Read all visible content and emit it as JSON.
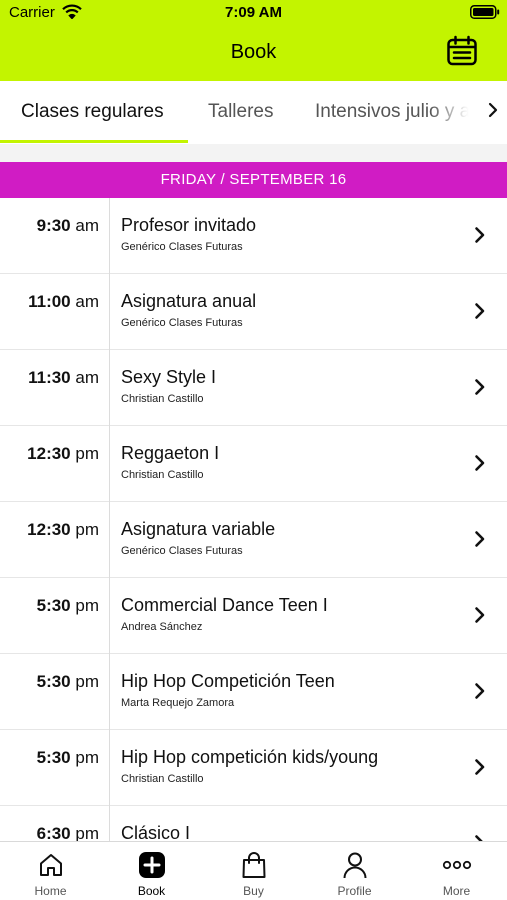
{
  "status_bar": {
    "carrier": "Carrier",
    "time": "7:09 AM"
  },
  "nav": {
    "title": "Book",
    "accent_color": "#c3f400",
    "calendar_icon": "calendar-icon"
  },
  "tabs": [
    {
      "label": "Clases regulares",
      "active": true
    },
    {
      "label": "Talleres",
      "active": false
    },
    {
      "label": "Intensivos julio y a",
      "active": false
    }
  ],
  "date_header": {
    "label": "FRIDAY / SEPTEMBER 16",
    "color": "#d01cc4"
  },
  "classes": [
    {
      "time": "9:30",
      "ampm": "am",
      "title": "Profesor invitado",
      "instructor": "Genérico Clases Futuras"
    },
    {
      "time": "11:00",
      "ampm": "am",
      "title": "Asignatura anual",
      "instructor": "Genérico Clases Futuras"
    },
    {
      "time": "11:30",
      "ampm": "am",
      "title": "Sexy Style I",
      "instructor": "Christian Castillo"
    },
    {
      "time": "12:30",
      "ampm": "pm",
      "title": "Reggaeton I",
      "instructor": "Christian Castillo"
    },
    {
      "time": "12:30",
      "ampm": "pm",
      "title": "Asignatura variable",
      "instructor": "Genérico Clases Futuras"
    },
    {
      "time": "5:30",
      "ampm": "pm",
      "title": "Commercial Dance Teen I",
      "instructor": "Andrea Sánchez"
    },
    {
      "time": "5:30",
      "ampm": "pm",
      "title": "Hip Hop Competición Teen",
      "instructor": "Marta Requejo Zamora"
    },
    {
      "time": "5:30",
      "ampm": "pm",
      "title": "Hip Hop competición kids/young",
      "instructor": "Christian Castillo"
    },
    {
      "time": "6:30",
      "ampm": "pm",
      "title": "Clásico I",
      "instructor": ""
    }
  ],
  "tab_bar": [
    {
      "label": "Home",
      "icon": "home-icon",
      "active": false
    },
    {
      "label": "Book",
      "icon": "plus-square-icon",
      "active": true
    },
    {
      "label": "Buy",
      "icon": "shopping-bag-icon",
      "active": false
    },
    {
      "label": "Profile",
      "icon": "user-icon",
      "active": false
    },
    {
      "label": "More",
      "icon": "more-icon",
      "active": false
    }
  ]
}
